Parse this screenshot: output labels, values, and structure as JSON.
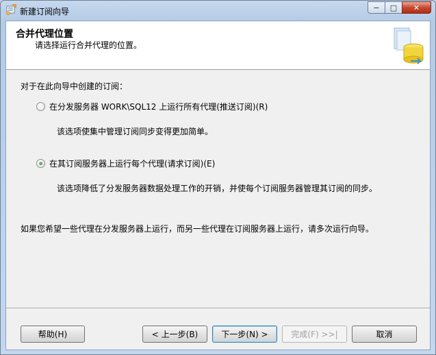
{
  "window": {
    "title": "新建订阅向导",
    "minimize_glyph": "−",
    "maximize_glyph": "□",
    "close_glyph": "✕"
  },
  "header": {
    "title": "合并代理位置",
    "subtitle": "请选择运行合并代理的位置。",
    "graphic_icon": "database-wizard-icon"
  },
  "body": {
    "lead": "对于在此向导中创建的订阅：",
    "options": [
      {
        "label": "在分发服务器 WORK\\SQL12 上运行所有代理(推送订阅)(R)",
        "description": "该选项使集中管理订阅同步变得更加简单。",
        "checked": false
      },
      {
        "label": "在其订阅服务器上运行每个代理(请求订阅)(E)",
        "description": "该选项降低了分发服务器数据处理工作的开销，并使每个订阅服务器管理其订阅的同步。",
        "checked": true
      }
    ],
    "note": "如果您希望一些代理在分发服务器上运行，而另一些代理在订阅服务器上运行，请多次运行向导。"
  },
  "buttons": {
    "help": "帮助(H)",
    "back": "< 上一步(B)",
    "next": "下一步(N) >",
    "finish": "完成(F) >>|",
    "cancel": "取消"
  },
  "colors": {
    "accent_close": "#c74a32",
    "default_button_border": "#3c7fb1",
    "header_background": "#ffffff",
    "client_background": "#f0f0f0"
  }
}
